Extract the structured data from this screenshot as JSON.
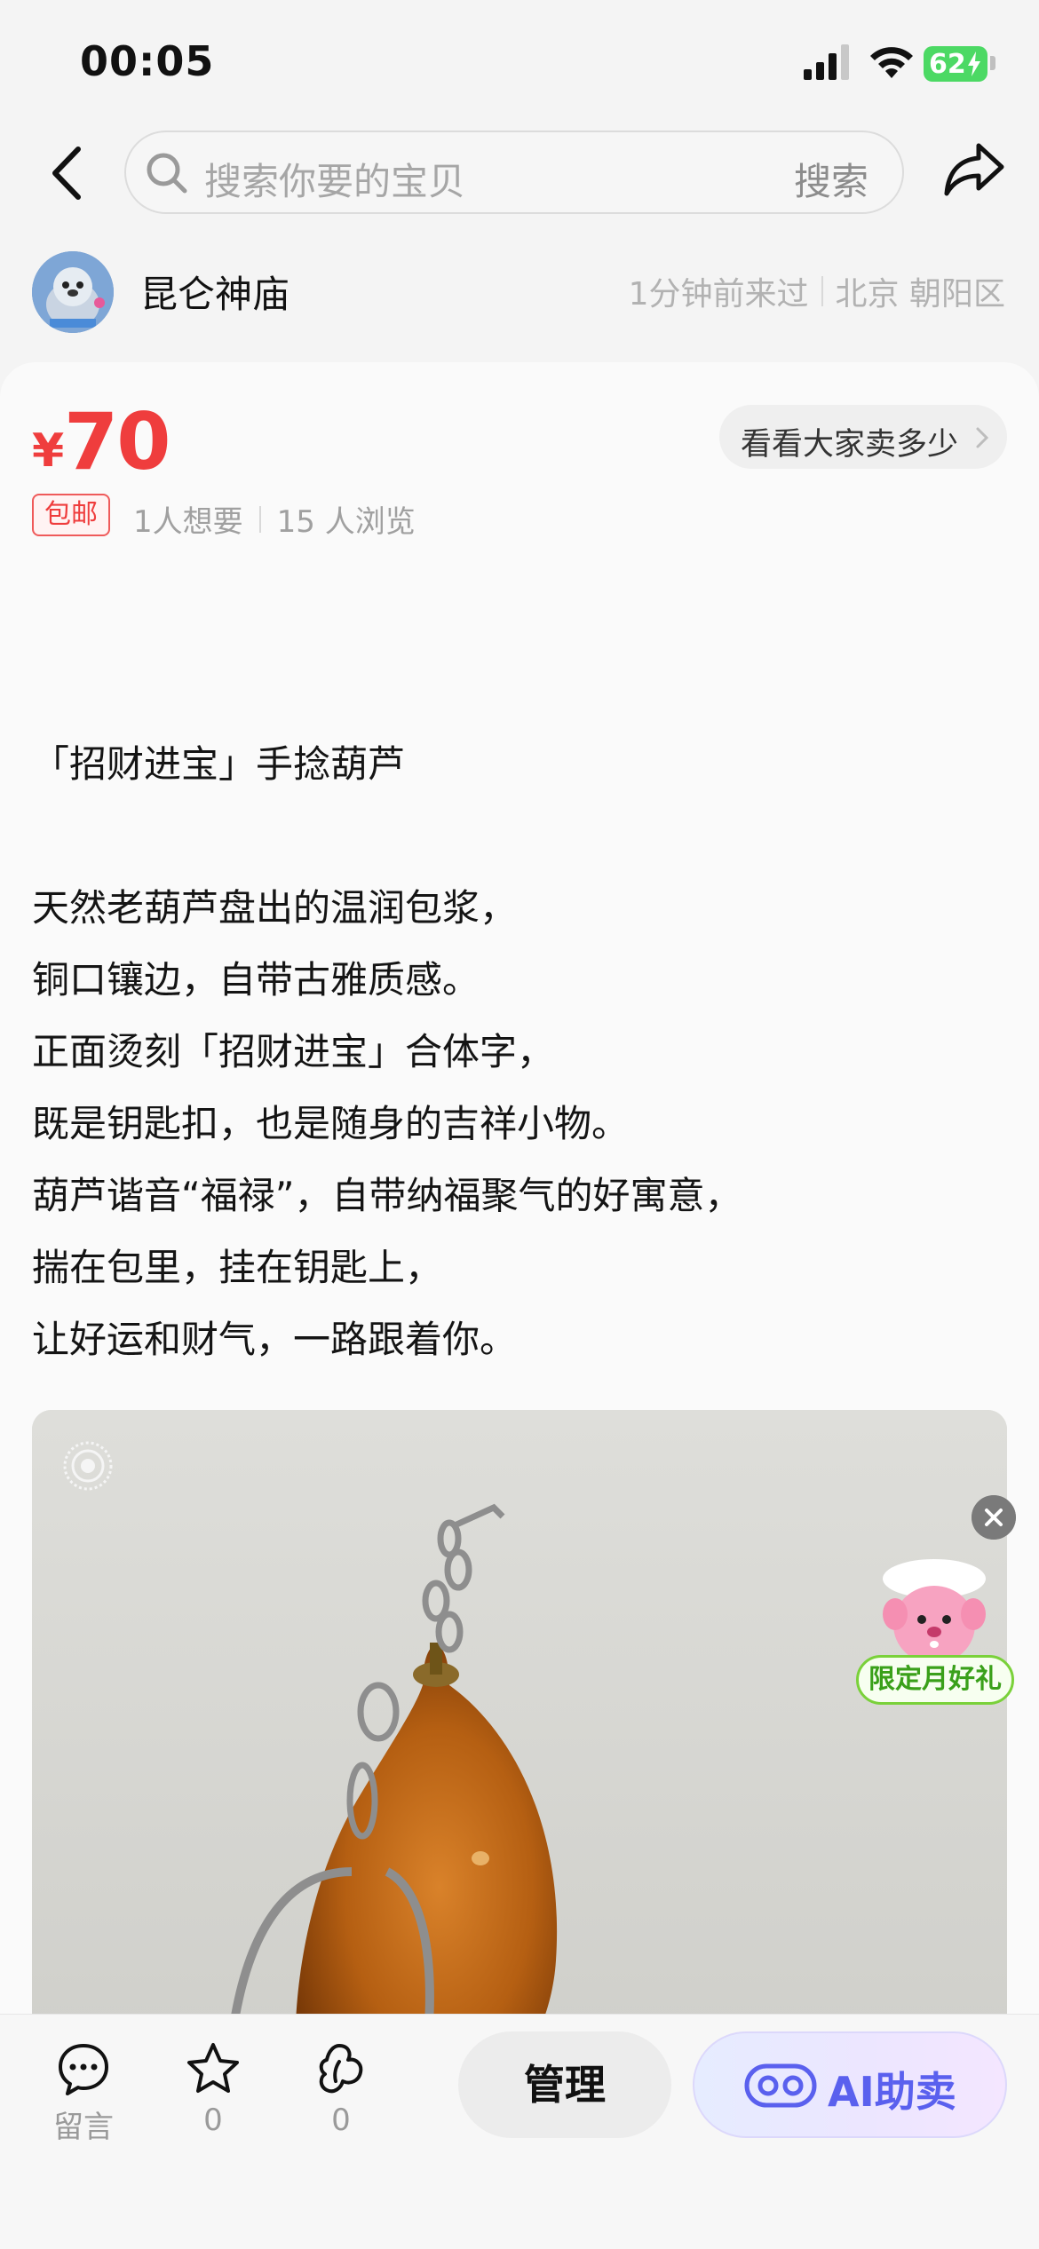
{
  "status_bar": {
    "time": "00:05",
    "battery": "62"
  },
  "nav": {
    "search_placeholder": "搜索你要的宝贝",
    "search_button": "搜索"
  },
  "seller": {
    "name": "昆仑神庙",
    "last_seen": "1分钟前来过",
    "location": "北京 朝阳区"
  },
  "listing": {
    "currency": "¥",
    "price": "70",
    "compare_button": "看看大家卖多少",
    "tag_free_shipping": "包邮",
    "wants": "1人想要",
    "views": "15 人浏览",
    "description": [
      "「招财进宝」手捻葫芦",
      "",
      "天然老葫芦盘出的温润包浆，",
      "铜口镶边，自带古雅质感。",
      "正面烫刻「招财进宝」合体字，",
      "既是钥匙扣，也是随身的吉祥小物。",
      "葫芦谐音“福禄”，自带纳福聚气的好寓意，",
      "揣在包里，挂在钥匙上，",
      "让好运和财气，一路跟着你。"
    ]
  },
  "promo": {
    "label": "限定月好礼"
  },
  "bottom_bar": {
    "comment_label": "留言",
    "favorite_count": "0",
    "like_count": "0",
    "manage_button": "管理",
    "ai_button": "AI助卖"
  },
  "colors": {
    "price": "#ef3d3d",
    "ai_accent": "#5a60ee",
    "promo_green": "#7ad13a"
  }
}
